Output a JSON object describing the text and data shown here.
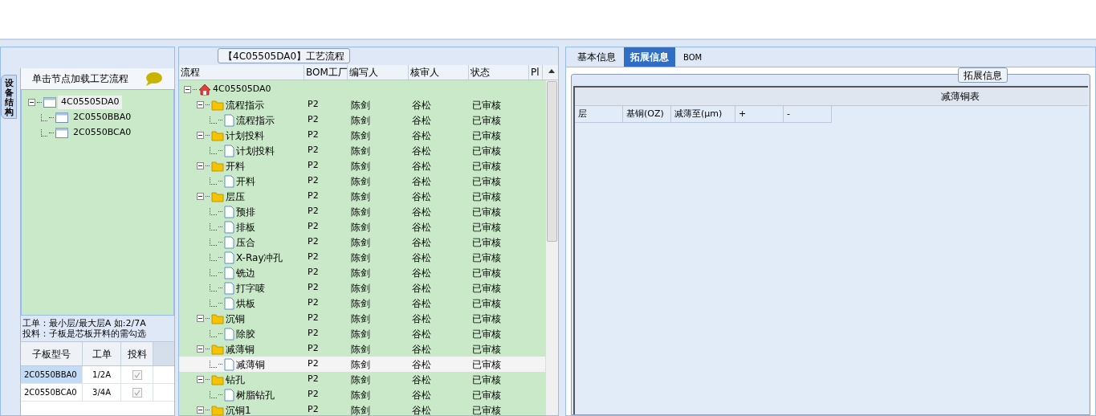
{
  "left_panel": {
    "side_tab": {
      "label": "设备结构",
      "selected": true
    },
    "header": "单击节点加载工艺流程",
    "tree": [
      {
        "label": "4C05505DA0",
        "expanded": true,
        "selected": true,
        "children": [
          {
            "label": "2C0550BBA0"
          },
          {
            "label": "2C0550BCA0"
          }
        ]
      }
    ],
    "notes": [
      "工单：最小层/最大层A 如:2/7A",
      "投料：子板是芯板开料的需勾选"
    ],
    "grid": {
      "columns": [
        "子板型号",
        "工单",
        "投料"
      ],
      "rows": [
        {
          "board": "2C0550BBA0",
          "order": "1/2A",
          "feed": true,
          "selected": true
        },
        {
          "board": "2C0550BCA0",
          "order": "3/4A",
          "feed": true,
          "selected": false
        }
      ]
    }
  },
  "process_panel": {
    "title": "【4C05505DA0】工艺流程",
    "columns": [
      "流程",
      "BOM工厂",
      "编写人",
      "核审人",
      "状态",
      "Pl"
    ],
    "tree": [
      {
        "label": "4C05505DA0",
        "kind": "root",
        "expanded": true,
        "selected": false,
        "children": [
          {
            "label": "流程指示",
            "kind": "folder",
            "expanded": true,
            "selected": false,
            "bom": "P2",
            "author": "陈剑",
            "reviewer": "谷松",
            "status": "已审核",
            "children": [
              {
                "label": "流程指示",
                "kind": "file",
                "selected": false,
                "bom": "P2",
                "author": "陈剑",
                "reviewer": "谷松",
                "status": "已审核"
              }
            ]
          },
          {
            "label": "计划投料",
            "kind": "folder",
            "expanded": true,
            "selected": false,
            "bom": "P2",
            "author": "陈剑",
            "reviewer": "谷松",
            "status": "已审核",
            "children": [
              {
                "label": "计划投料",
                "kind": "file",
                "selected": false,
                "bom": "P2",
                "author": "陈剑",
                "reviewer": "谷松",
                "status": "已审核"
              }
            ]
          },
          {
            "label": "开料",
            "kind": "folder",
            "expanded": true,
            "selected": false,
            "bom": "P2",
            "author": "陈剑",
            "reviewer": "谷松",
            "status": "已审核",
            "children": [
              {
                "label": "开料",
                "kind": "file",
                "selected": false,
                "bom": "P2",
                "author": "陈剑",
                "reviewer": "谷松",
                "status": "已审核"
              }
            ]
          },
          {
            "label": "层压",
            "kind": "folder",
            "expanded": true,
            "selected": false,
            "bom": "P2",
            "author": "陈剑",
            "reviewer": "谷松",
            "status": "已审核",
            "children": [
              {
                "label": "预排",
                "kind": "file",
                "selected": false,
                "bom": "P2",
                "author": "陈剑",
                "reviewer": "谷松",
                "status": "已审核"
              },
              {
                "label": "排板",
                "kind": "file",
                "selected": false,
                "bom": "P2",
                "author": "陈剑",
                "reviewer": "谷松",
                "status": "已审核"
              },
              {
                "label": "压合",
                "kind": "file",
                "selected": false,
                "bom": "P2",
                "author": "陈剑",
                "reviewer": "谷松",
                "status": "已审核"
              },
              {
                "label": "X-Ray冲孔",
                "kind": "file",
                "selected": false,
                "bom": "P2",
                "author": "陈剑",
                "reviewer": "谷松",
                "status": "已审核"
              },
              {
                "label": "铣边",
                "kind": "file",
                "selected": false,
                "bom": "P2",
                "author": "陈剑",
                "reviewer": "谷松",
                "status": "已审核"
              },
              {
                "label": "打字唛",
                "kind": "file",
                "selected": false,
                "bom": "P2",
                "author": "陈剑",
                "reviewer": "谷松",
                "status": "已审核"
              },
              {
                "label": "烘板",
                "kind": "file",
                "selected": false,
                "bom": "P2",
                "author": "陈剑",
                "reviewer": "谷松",
                "status": "已审核"
              }
            ]
          },
          {
            "label": "沉铜",
            "kind": "folder",
            "expanded": true,
            "selected": false,
            "bom": "P2",
            "author": "陈剑",
            "reviewer": "谷松",
            "status": "已审核",
            "children": [
              {
                "label": "除胶",
                "kind": "file",
                "selected": false,
                "bom": "P2",
                "author": "陈剑",
                "reviewer": "谷松",
                "status": "已审核"
              }
            ]
          },
          {
            "label": "减薄铜",
            "kind": "folder",
            "expanded": true,
            "selected": false,
            "bom": "P2",
            "author": "陈剑",
            "reviewer": "谷松",
            "status": "已审核",
            "children": [
              {
                "label": "减薄铜",
                "kind": "file",
                "selected": true,
                "bom": "P2",
                "author": "陈剑",
                "reviewer": "谷松",
                "status": "已审核"
              }
            ]
          },
          {
            "label": "钻孔",
            "kind": "folder",
            "expanded": true,
            "selected": false,
            "bom": "P2",
            "author": "陈剑",
            "reviewer": "谷松",
            "status": "已审核",
            "children": [
              {
                "label": "树脂钻孔",
                "kind": "file",
                "selected": false,
                "bom": "P2",
                "author": "陈剑",
                "reviewer": "谷松",
                "status": "已审核"
              }
            ]
          },
          {
            "label": "沉铜1",
            "kind": "folder",
            "expanded": true,
            "selected": false,
            "bom": "P2",
            "author": "陈剑",
            "reviewer": "谷松",
            "status": "已审核"
          }
        ]
      }
    ]
  },
  "detail_panel": {
    "tabs": [
      {
        "label": "基本信息",
        "selected": false
      },
      {
        "label": "拓展信息",
        "selected": true
      },
      {
        "label": "BOM",
        "selected": false
      }
    ],
    "group_title": "拓展信息",
    "table": {
      "title": "减薄铜表",
      "columns": [
        "层",
        "基铜(OZ)",
        "减薄至(μm)",
        "+",
        "-"
      ]
    }
  }
}
